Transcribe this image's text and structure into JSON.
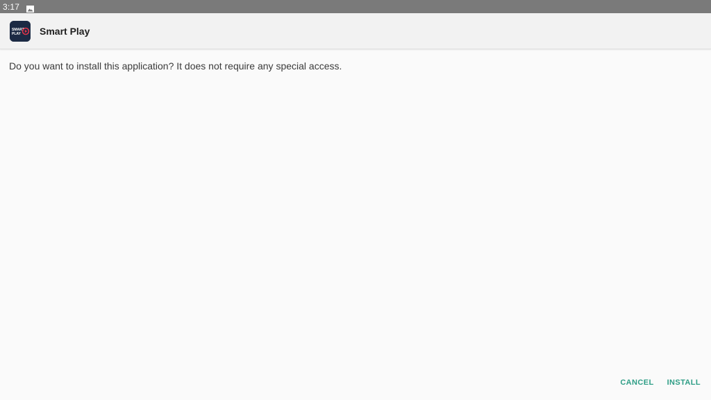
{
  "status_bar": {
    "time": "3:17",
    "notification_icon": "image-notification-icon"
  },
  "header": {
    "app_name": "Smart Play",
    "app_icon": "smart-play-logo-icon",
    "app_icon_text_line1": "SMART",
    "app_icon_text_line2": "PLAY"
  },
  "content": {
    "message": "Do you want to install this application? It does not require any special access."
  },
  "actions": {
    "cancel_label": "CANCEL",
    "install_label": "INSTALL"
  },
  "colors": {
    "accent": "#2e9e86",
    "status_bar": "#7a7a7a",
    "background": "#fafafa"
  }
}
